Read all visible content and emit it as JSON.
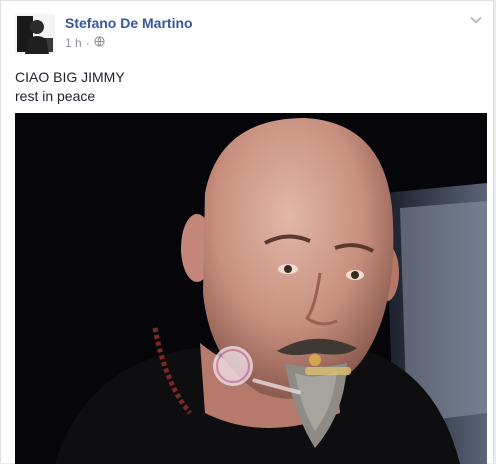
{
  "post": {
    "author": "Stefano De Martino",
    "timestamp": "1 h",
    "separator": "·",
    "audience_icon": "globe-icon",
    "options_icon": "chevron-down-icon",
    "text_lines": [
      "CIAO BIG JIMMY",
      "rest in peace"
    ]
  },
  "photo": {
    "subject": "photo-bald-bearded-man",
    "watermark_icon": "watermark-logo"
  }
}
